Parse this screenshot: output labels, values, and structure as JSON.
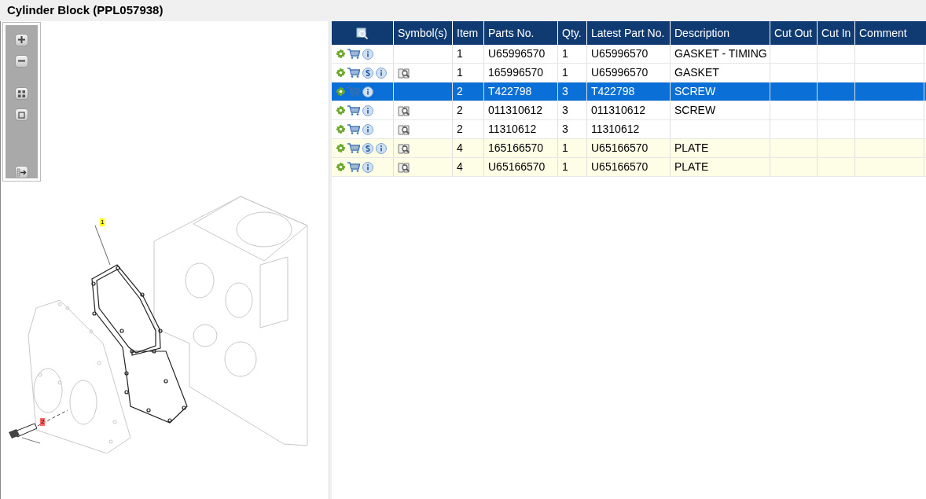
{
  "window": {
    "title": "Cylinder Block (PPL057938)"
  },
  "diagram": {
    "callouts": [
      {
        "label": "1",
        "color": "#ffff00"
      },
      {
        "label": "2",
        "color": "#ff6666"
      }
    ]
  },
  "table": {
    "columns": [
      "Symbol(s)",
      "Item",
      "Parts No.",
      "Qty.",
      "Latest Part No.",
      "Description",
      "Cut Out",
      "Cut In",
      "Comment"
    ],
    "rows": [
      {
        "has_s": false,
        "has_symbol": false,
        "selected": false,
        "highlighted": false,
        "item": "1",
        "parts_no": "U65996570",
        "qty": "1",
        "latest_part_no": "U65996570",
        "description": "GASKET - TIMING"
      },
      {
        "has_s": true,
        "has_symbol": true,
        "selected": false,
        "highlighted": false,
        "item": "1",
        "parts_no": "165996570",
        "qty": "1",
        "latest_part_no": "U65996570",
        "description": "GASKET"
      },
      {
        "has_s": false,
        "has_symbol": false,
        "selected": true,
        "highlighted": false,
        "item": "2",
        "parts_no": "T422798",
        "qty": "3",
        "latest_part_no": "T422798",
        "description": "SCREW"
      },
      {
        "has_s": false,
        "has_symbol": true,
        "selected": false,
        "highlighted": false,
        "item": "2",
        "parts_no": "011310612",
        "qty": "3",
        "latest_part_no": "011310612",
        "description": "SCREW"
      },
      {
        "has_s": false,
        "has_symbol": true,
        "selected": false,
        "highlighted": false,
        "item": "2",
        "parts_no": "11310612",
        "qty": "3",
        "latest_part_no": "11310612"
      },
      {
        "has_s": true,
        "has_symbol": true,
        "selected": false,
        "highlighted": true,
        "item": "4",
        "parts_no": "165166570",
        "qty": "1",
        "latest_part_no": "U65166570",
        "description": "PLATE"
      },
      {
        "has_s": false,
        "has_symbol": true,
        "selected": false,
        "highlighted": true,
        "item": "4",
        "parts_no": "U65166570",
        "qty": "1",
        "latest_part_no": "U65166570",
        "description": "PLATE"
      }
    ]
  }
}
